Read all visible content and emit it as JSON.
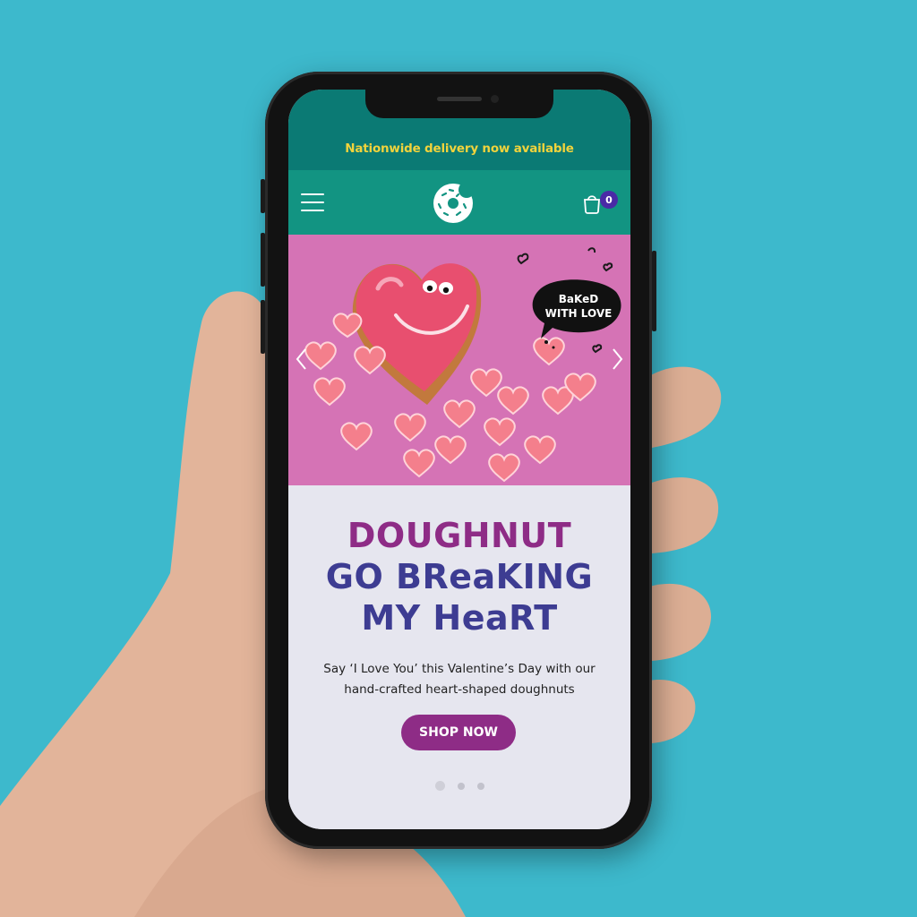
{
  "colors": {
    "background": "#3db9cc",
    "promo_bar": "#0b7a74",
    "promo_text": "#f1d33c",
    "header": "#129482",
    "hero_bg": "#d573b5",
    "title_purple": "#8e2c86",
    "title_indigo": "#3d3c92",
    "button": "#8e2c86",
    "cart_badge": "#4a2aa6"
  },
  "promo": {
    "text": "Nationwide delivery now available"
  },
  "header": {
    "menu_icon": "hamburger-menu-icon",
    "logo_icon": "doughnut-logo-icon",
    "cart_icon": "shopping-bag-icon",
    "cart_count": "0"
  },
  "hero": {
    "sticker_text_1": "BaKeD",
    "sticker_text_2": "WITH LOVE",
    "prev_icon": "chevron-left-icon",
    "next_icon": "chevron-right-icon"
  },
  "content": {
    "title_line_1": "DOUGHNUT",
    "title_line_2": "GO BReaKING",
    "title_line_3": "MY HeaRT",
    "description_line_1": "Say ‘I Love You’ this Valentine’s Day with our",
    "description_line_2": "hand-crafted heart-shaped doughnuts",
    "cta_label": "SHOP NOW"
  },
  "carousel": {
    "slide_count": 3,
    "active_index": 0
  }
}
